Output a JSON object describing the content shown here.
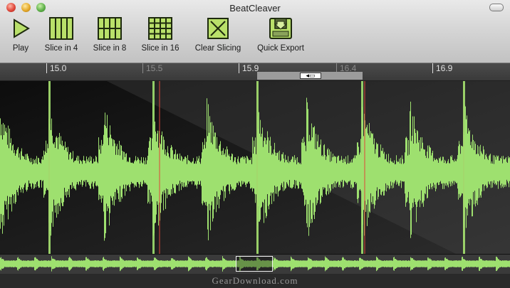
{
  "window": {
    "title": "BeatCleaver"
  },
  "toolbar": {
    "play": "Play",
    "slice4": "Slice in 4",
    "slice8": "Slice in 8",
    "slice16": "Slice in 16",
    "clear": "Clear Slicing",
    "export": "Quick Export"
  },
  "ruler": {
    "ticks": [
      {
        "label": "15.0",
        "dim": false
      },
      {
        "label": "15.5",
        "dim": true
      },
      {
        "label": "15.9",
        "dim": false
      },
      {
        "label": "16.4",
        "dim": true
      },
      {
        "label": "16.9",
        "dim": false
      }
    ]
  },
  "waveform": {
    "wave_color": "#9ee06f",
    "slice_color": "#e0473a",
    "slices_count": 8
  },
  "watermark": "GearDownload.com",
  "colors": {
    "toolbar_icon_fill": "#b9e06a",
    "toolbar_icon_stroke": "#2b3a14"
  }
}
